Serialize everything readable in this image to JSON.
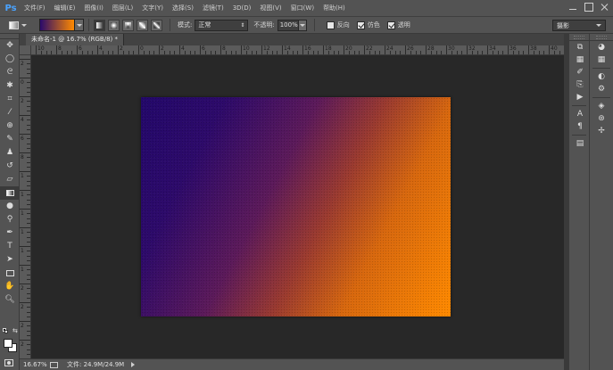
{
  "app": {
    "logo_text": "Ps"
  },
  "menu": {
    "items": [
      "文件(F)",
      "编辑(E)",
      "图像(I)",
      "图层(L)",
      "文字(Y)",
      "选择(S)",
      "滤镜(T)",
      "3D(D)",
      "视图(V)",
      "窗口(W)",
      "帮助(H)"
    ]
  },
  "options_bar": {
    "mode_label": "模式:",
    "mode_value": "正常",
    "opacity_label": "不透明:",
    "opacity_value": "100%",
    "reverse_label": "反向",
    "dither_label": "仿色",
    "transparency_label": "透明",
    "reverse_checked": false,
    "dither_checked": true,
    "transparency_checked": true,
    "gradient_colors": [
      "#2a0a6b",
      "#ff8a00"
    ],
    "workspace_value": "摄影"
  },
  "document": {
    "tab_title": "未命名-1 @ 16.7% (RGB/8) *",
    "gradient_start_color": "#23086a",
    "gradient_end_color": "#ff8a00"
  },
  "rulers": {
    "top_labels": [
      "10",
      "8",
      "6",
      "4",
      "2",
      "0",
      "2",
      "4",
      "6",
      "8",
      "10",
      "12",
      "14",
      "16",
      "18",
      "20",
      "22",
      "24",
      "26",
      "28",
      "30",
      "32",
      "34",
      "36",
      "38",
      "40"
    ],
    "left_labels": [
      "2",
      "0",
      "2",
      "4",
      "6",
      "8",
      "1",
      "1",
      "1",
      "1",
      "1",
      "1",
      "2",
      "2",
      "2",
      "2"
    ]
  },
  "status": {
    "zoom": "16.67%",
    "doc_info": "文件: 24.9M/24.9M"
  },
  "colors": {
    "foreground": "#ffffff",
    "background": "#ffffff"
  }
}
